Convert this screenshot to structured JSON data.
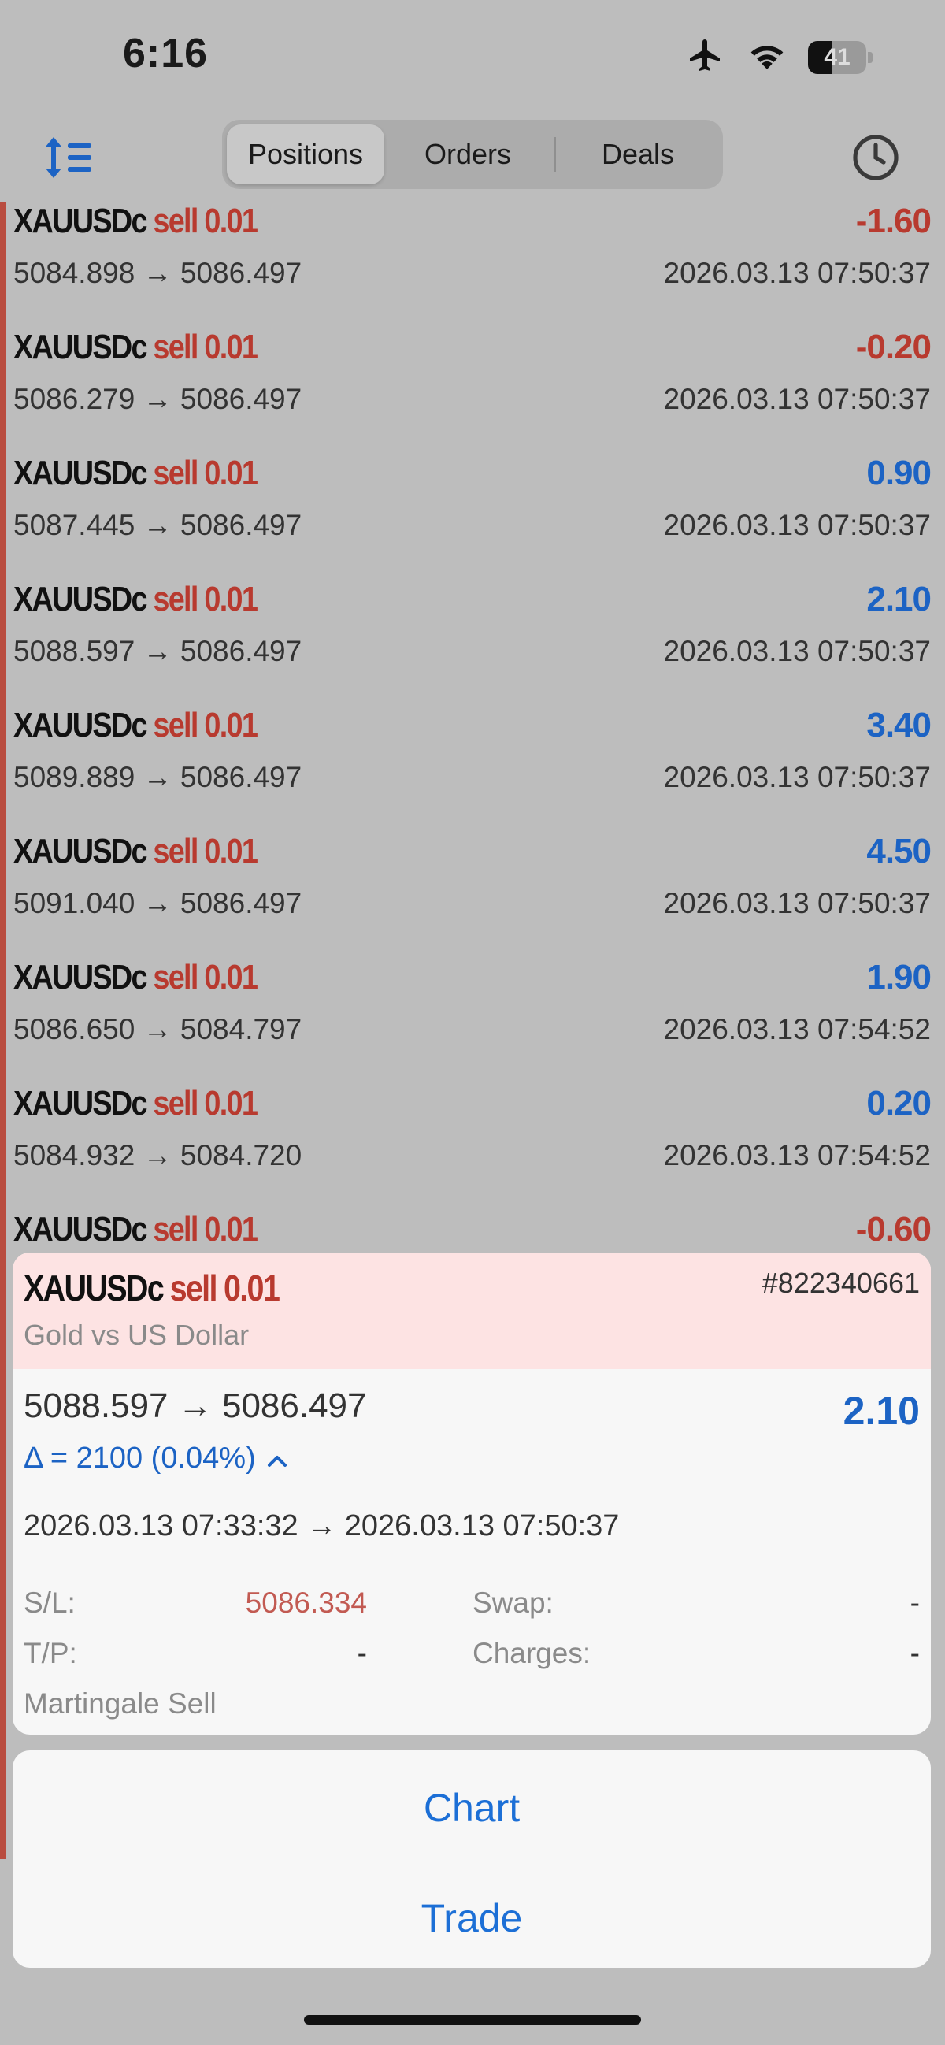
{
  "status_bar": {
    "time": "6:16",
    "battery": "41",
    "battery_level": 0.41,
    "icons": [
      "airplane-mode-icon",
      "wifi-icon",
      "battery-icon"
    ]
  },
  "toolbar": {
    "sort_icon": "sort-icon",
    "history_icon": "clock-icon",
    "tabs": [
      {
        "label": "Positions",
        "active": true
      },
      {
        "label": "Orders",
        "active": false
      },
      {
        "label": "Deals",
        "active": false
      }
    ]
  },
  "colors": {
    "accent_blue": "#1c63c4",
    "loss_red": "#b83a2f",
    "overlay_gray": "#bdbdbd",
    "card_header_pink": "#fde3e3"
  },
  "positions": [
    {
      "symbol": "XAUUSDc",
      "side": "sell 0.01",
      "prices": "5084.898 → 5086.497",
      "time": "2026.03.13 07:50:37",
      "profit": "-1.60",
      "negative": true
    },
    {
      "symbol": "XAUUSDc",
      "side": "sell 0.01",
      "prices": "5086.279 → 5086.497",
      "time": "2026.03.13 07:50:37",
      "profit": "-0.20",
      "negative": true
    },
    {
      "symbol": "XAUUSDc",
      "side": "sell 0.01",
      "prices": "5087.445 → 5086.497",
      "time": "2026.03.13 07:50:37",
      "profit": "0.90",
      "negative": false
    },
    {
      "symbol": "XAUUSDc",
      "side": "sell 0.01",
      "prices": "5088.597 → 5086.497",
      "time": "2026.03.13 07:50:37",
      "profit": "2.10",
      "negative": false
    },
    {
      "symbol": "XAUUSDc",
      "side": "sell 0.01",
      "prices": "5089.889 → 5086.497",
      "time": "2026.03.13 07:50:37",
      "profit": "3.40",
      "negative": false
    },
    {
      "symbol": "XAUUSDc",
      "side": "sell 0.01",
      "prices": "5091.040 → 5086.497",
      "time": "2026.03.13 07:50:37",
      "profit": "4.50",
      "negative": false
    },
    {
      "symbol": "XAUUSDc",
      "side": "sell 0.01",
      "prices": "5086.650 → 5084.797",
      "time": "2026.03.13 07:54:52",
      "profit": "1.90",
      "negative": false
    },
    {
      "symbol": "XAUUSDc",
      "side": "sell 0.01",
      "prices": "5084.932 → 5084.720",
      "time": "2026.03.13 07:54:52",
      "profit": "0.20",
      "negative": false
    },
    {
      "symbol": "XAUUSDc",
      "side": "sell 0.01",
      "prices": "",
      "time": "",
      "profit": "-0.60",
      "negative": true
    }
  ],
  "detail": {
    "symbol": "XAUUSDc",
    "side": "sell 0.01",
    "ticket": "#822340661",
    "description": "Gold vs US Dollar",
    "prices": "5088.597 → 5086.497",
    "profit": "2.10",
    "delta": "Δ = 2100 (0.04%)",
    "times": "2026.03.13 07:33:32 → 2026.03.13 07:50:37",
    "sl_label": "S/L:",
    "sl_value": "5086.334",
    "tp_label": "T/P:",
    "tp_value": "-",
    "swap_label": "Swap:",
    "swap_value": "-",
    "charges_label": "Charges:",
    "charges_value": "-",
    "comment": "Martingale Sell"
  },
  "actions": {
    "chart": "Chart",
    "trade": "Trade"
  }
}
